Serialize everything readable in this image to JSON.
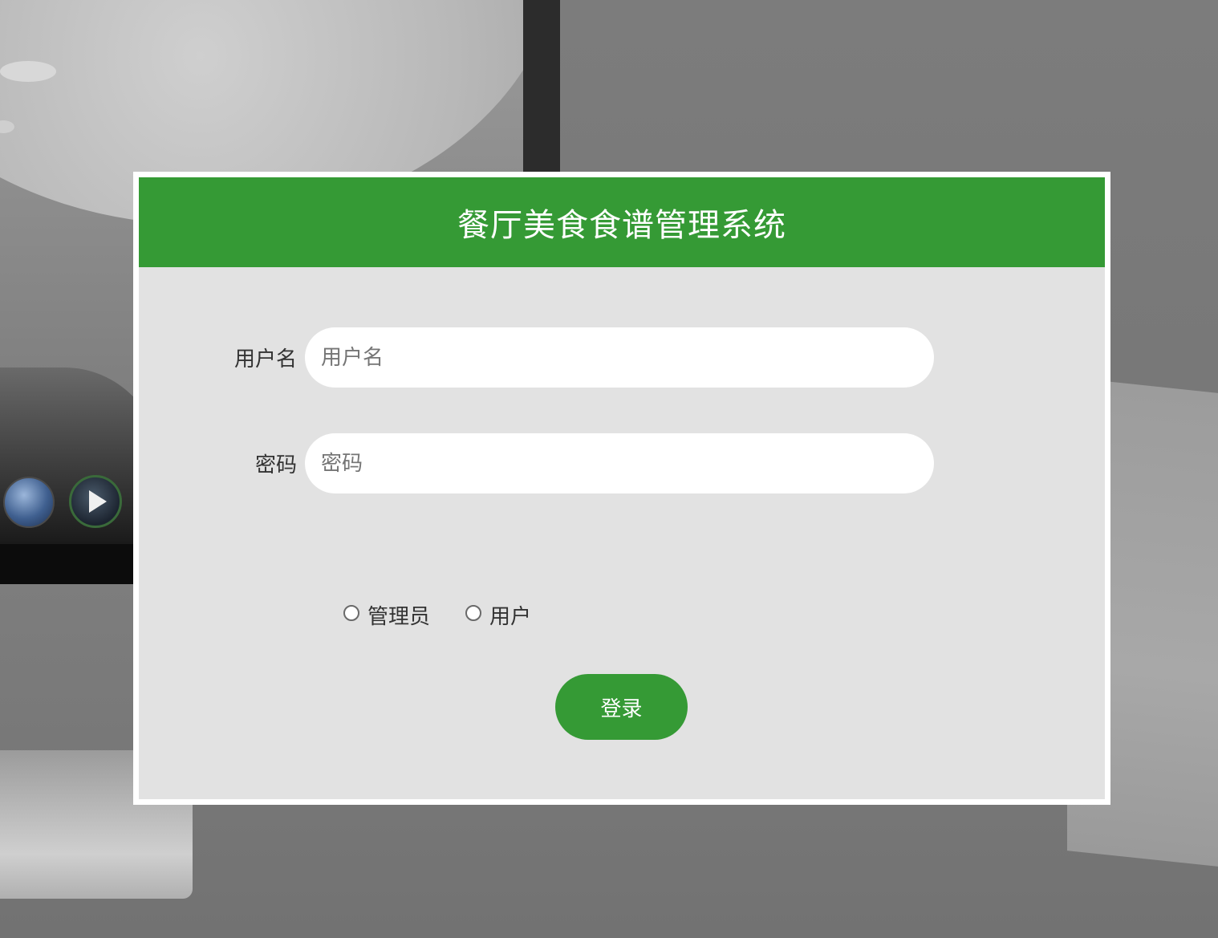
{
  "header": {
    "title": "餐厅美食食谱管理系统"
  },
  "form": {
    "username": {
      "label": "用户名",
      "placeholder": "用户名",
      "value": ""
    },
    "password": {
      "label": "密码",
      "placeholder": "密码",
      "value": ""
    },
    "roles": [
      {
        "label": "管理员",
        "checked": false
      },
      {
        "label": "用户",
        "checked": false
      }
    ],
    "login_label": "登录"
  },
  "colors": {
    "accent": "#359a35",
    "panel_border": "#ffffff",
    "panel_bg": "#d9d9d9",
    "text": "#333333"
  }
}
